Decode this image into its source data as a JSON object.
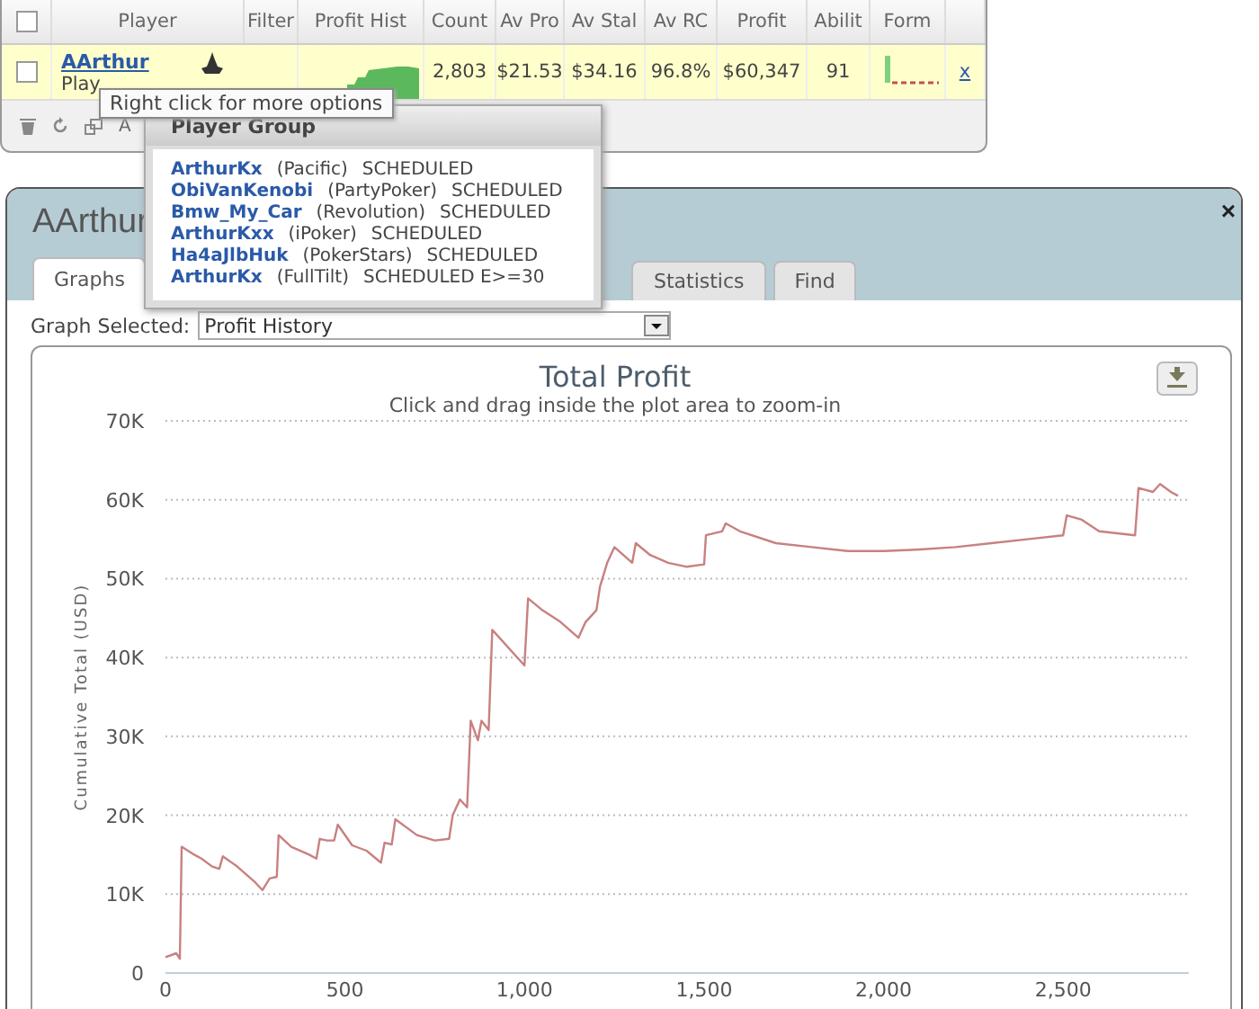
{
  "grid": {
    "columns": [
      "Player",
      "Filter",
      "Profit Hist",
      "Count",
      "Av Pro",
      "Av Stal",
      "Av RC",
      "Profit",
      "Abilit",
      "Form"
    ],
    "rows": [
      {
        "checked": false,
        "player": "AArthur",
        "sub": "Play",
        "count": "2,803",
        "av_pro": "$21.53",
        "av_stal": "$34.16",
        "av_rc": "96.8%",
        "profit": "$60,347",
        "ability": "91",
        "remove": "x"
      }
    ],
    "header_checked": false,
    "footer_text": "A"
  },
  "tooltip": "Right click for more options",
  "player_group": {
    "title": "Player Group",
    "items": [
      {
        "name": "ArthurKx",
        "site": "(Pacific)",
        "status": "SCHEDULED"
      },
      {
        "name": "ObiVanKenobi",
        "site": "(PartyPoker)",
        "status": "SCHEDULED"
      },
      {
        "name": "Bmw_My_Car",
        "site": "(Revolution)",
        "status": "SCHEDULED"
      },
      {
        "name": "ArthurKxx",
        "site": "(iPoker)",
        "status": "SCHEDULED"
      },
      {
        "name": "Ha4aJlbHuk",
        "site": "(PokerStars)",
        "status": "SCHEDULED"
      },
      {
        "name": "ArthurKx",
        "site": "(FullTilt)",
        "status": "SCHEDULED E>=30"
      }
    ]
  },
  "window": {
    "title": "AArthur",
    "close": "×",
    "tabs": [
      {
        "label": "Graphs",
        "selected": true
      },
      {
        "label": "Statistics",
        "selected": false
      },
      {
        "label": "Find",
        "selected": false
      }
    ],
    "graph_label": "Graph Selected:",
    "graph_value": "Profit History",
    "subtitle": "Click and drag inside the plot area to zoom-in",
    "chart_data": {
      "type": "line",
      "title": "Total Profit",
      "ylabel": "Cumulative Total (USD)",
      "x": [
        0,
        30,
        40,
        45,
        80,
        100,
        130,
        150,
        160,
        200,
        250,
        270,
        290,
        310,
        315,
        350,
        400,
        420,
        430,
        450,
        470,
        480,
        520,
        560,
        600,
        610,
        630,
        640,
        700,
        750,
        790,
        800,
        820,
        840,
        850,
        870,
        880,
        900,
        910,
        1000,
        1010,
        1050,
        1100,
        1150,
        1170,
        1200,
        1210,
        1230,
        1250,
        1300,
        1310,
        1350,
        1400,
        1450,
        1500,
        1505,
        1550,
        1560,
        1600,
        1700,
        1800,
        1900,
        2000,
        2100,
        2200,
        2300,
        2400,
        2500,
        2510,
        2550,
        2600,
        2700,
        2710,
        2750,
        2770,
        2800,
        2820
      ],
      "grid": true,
      "series": [
        {
          "color": "#c98080",
          "values": [
            2000,
            2500,
            1800,
            16000,
            15000,
            14500,
            13500,
            13200,
            14800,
            13500,
            11500,
            10500,
            12000,
            12200,
            17500,
            16000,
            15000,
            14500,
            17000,
            16800,
            16800,
            18800,
            16200,
            15500,
            14000,
            16500,
            16300,
            19500,
            17500,
            16800,
            17000,
            20000,
            22000,
            21000,
            32000,
            29500,
            32000,
            30800,
            43500,
            39000,
            47500,
            46000,
            44500,
            42500,
            44500,
            46000,
            49000,
            52000,
            54000,
            52000,
            54500,
            53000,
            52000,
            51500,
            51800,
            55500,
            56000,
            57000,
            56000,
            54500,
            54000,
            53500,
            53500,
            53700,
            54000,
            54500,
            55000,
            55500,
            58000,
            57500,
            56000,
            55500,
            61500,
            61000,
            62000,
            61000,
            60500
          ]
        }
      ],
      "xlim": [
        0,
        2850
      ],
      "ylim": [
        0,
        70000
      ],
      "xticks": [
        {
          "value": 0,
          "label": "0"
        },
        {
          "value": 500,
          "label": "500"
        },
        {
          "value": 1000,
          "label": "1,000"
        },
        {
          "value": 1500,
          "label": "1,500"
        },
        {
          "value": 2000,
          "label": "2,000"
        },
        {
          "value": 2500,
          "label": "2,500"
        }
      ],
      "yticks": [
        {
          "value": 0,
          "label": "0"
        },
        {
          "value": 10000,
          "label": "10K"
        },
        {
          "value": 20000,
          "label": "20K"
        },
        {
          "value": 30000,
          "label": "30K"
        },
        {
          "value": 40000,
          "label": "40K"
        },
        {
          "value": 50000,
          "label": "50K"
        },
        {
          "value": 60000,
          "label": "60K"
        },
        {
          "value": 70000,
          "label": "70K"
        }
      ]
    }
  }
}
